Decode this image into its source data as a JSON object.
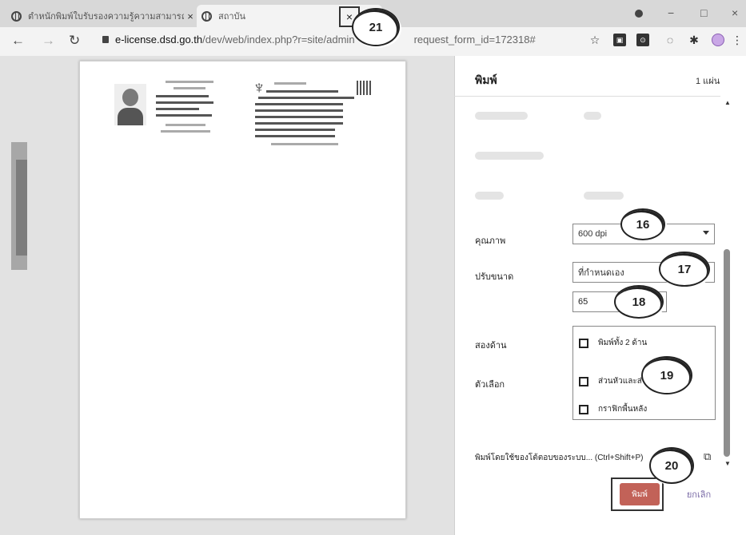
{
  "tabs": [
    {
      "title": "ตำหนักพิมพ์ใบรับรองความรู้ความสามารถ",
      "close": "×"
    },
    {
      "title": "สถาบัน",
      "close": "×"
    }
  ],
  "window_controls": {
    "minimize": "−",
    "maximize": "□",
    "close": "×"
  },
  "address": {
    "url_host": "e-license.dsd.go.th",
    "url_path_before": "/dev/web/index.php?r=site/admin",
    "url_path_after": "request_form_id=172318#"
  },
  "print_panel": {
    "title": "พิมพ์",
    "sheet_count": "1 แผ่น",
    "quality_label": "คุณภาพ",
    "quality_value": "600 dpi",
    "scale_label": "ปรับขนาด",
    "scale_value": "ที่กำหนดเอง",
    "scale_number": "65",
    "duplex_label": "สองด้าน",
    "duplex_option": "พิมพ์ทั้ง 2 ด้าน",
    "options_label": "ตัวเลือก",
    "option_headers": "ส่วนหัวและส่วนท้าย",
    "option_background": "กราฟิกพื้นหลัง",
    "system_dialog": "พิมพ์โดยใช้ของโต้ตอบของระบบ... (Ctrl+Shift+P)",
    "print_button": "พิมพ์",
    "cancel_button": "ยกเลิก"
  },
  "callouts": {
    "c16": "16",
    "c17": "17",
    "c18": "18",
    "c19": "19",
    "c20": "20",
    "c21": "21"
  }
}
